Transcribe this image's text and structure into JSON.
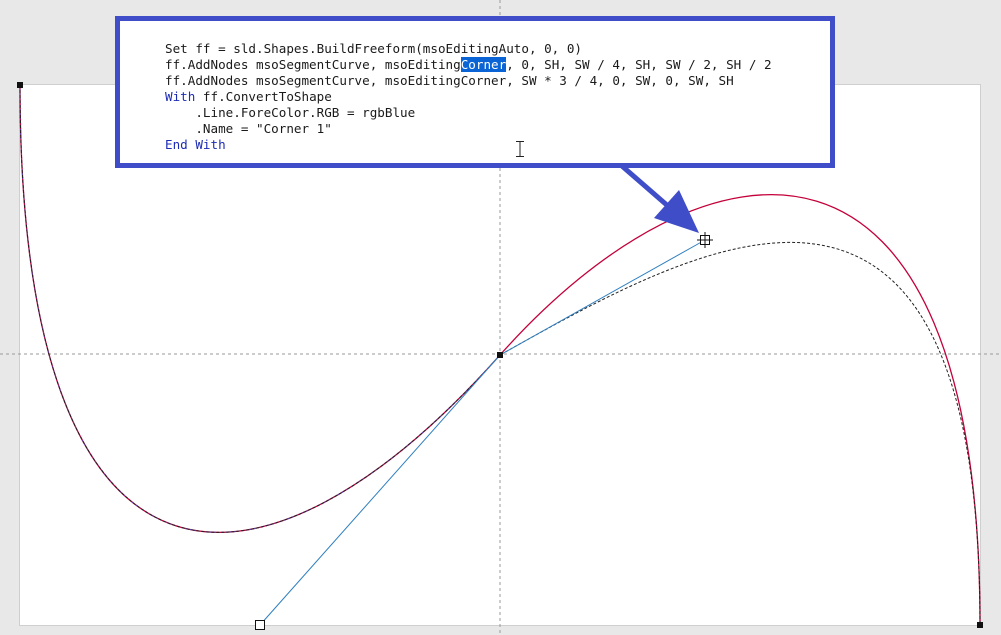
{
  "code_panel": {
    "line1": "Set ff = sld.Shapes.BuildFreeform(msoEditingAuto, 0, 0)",
    "line2_before": "ff.AddNodes msoSegmentCurve, msoEditing",
    "line2_selected": "Corner",
    "line2_after": ", 0, SH, SW / 4, SH, SW / 2, SH / 2",
    "line3": "ff.AddNodes msoSegmentCurve, msoEditingCorner, SW * 3 / 4, 0, SW, 0, SW, SH",
    "line4_keyword": "With",
    "line4_rest": " ff.ConvertToShape",
    "line5": "    .Line.ForeColor.RGB = rgbBlue",
    "line6": "    .Name = \"Corner 1\"",
    "line7": "End With",
    "border_color": "#3f4dc8",
    "selection_color": "#0a64d6"
  },
  "icons": {
    "cursor": "text-cursor-icon",
    "arrow": "callout-arrow-icon",
    "node_handle": "square-handle-icon",
    "rotate_handle": "move-handle-icon"
  },
  "colors": {
    "shape_outline": "#c4003a",
    "dashed_outline": "#222222",
    "tangent_line": "#2f7fbf",
    "callout": "#3f4dc8"
  }
}
